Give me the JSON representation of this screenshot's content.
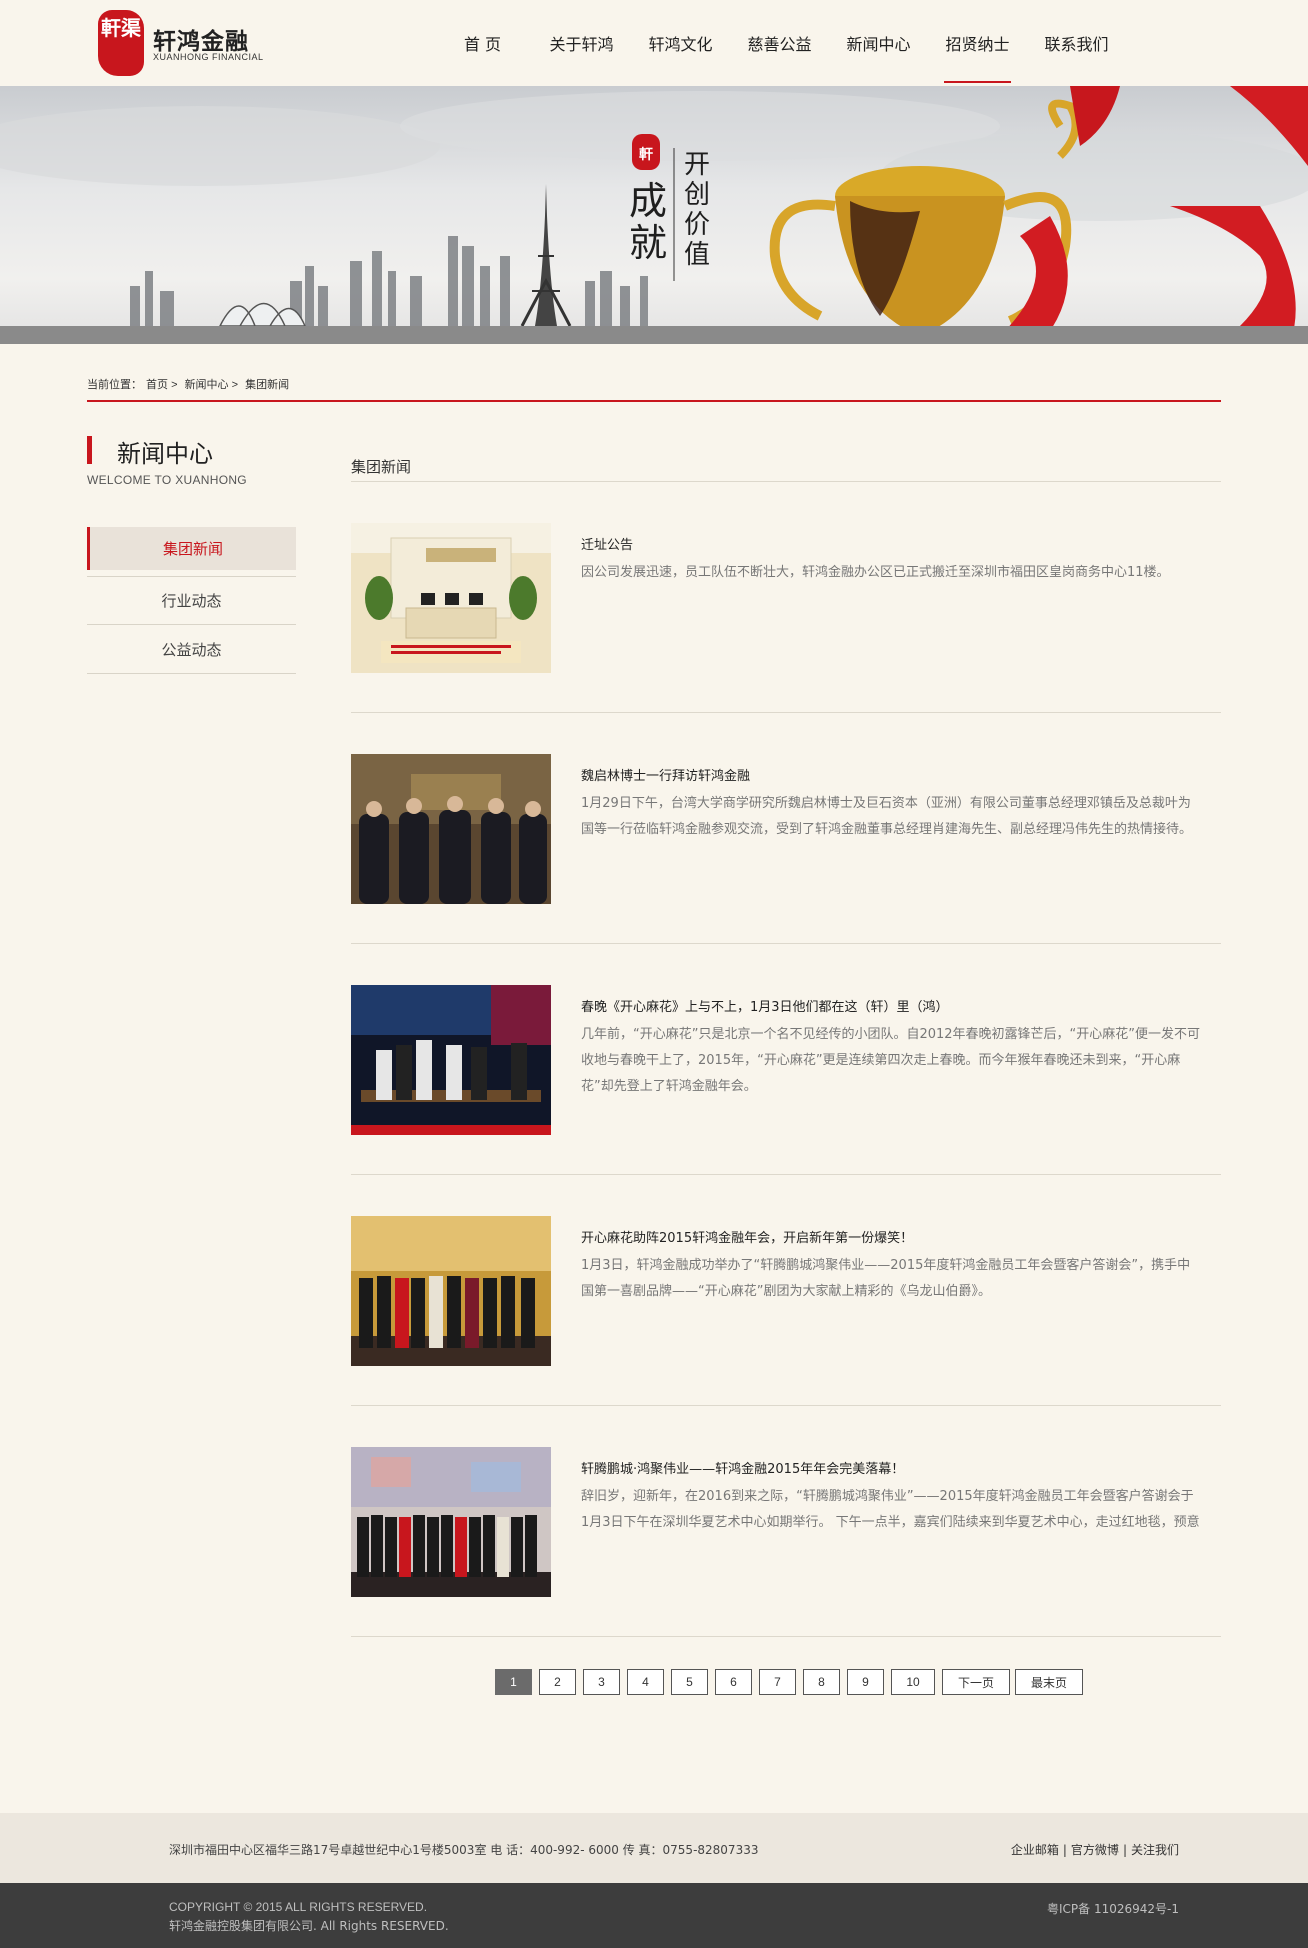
{
  "brand": {
    "seal_text": "軒渠",
    "name_cn": "轩鸿金融",
    "name_en": "XUANHONG FINANCIAL",
    "accent_color": "#c8161d"
  },
  "nav": {
    "items": [
      {
        "label": "首 页"
      },
      {
        "label": "关于轩鸿"
      },
      {
        "label": "轩鸿文化"
      },
      {
        "label": "慈善公益"
      },
      {
        "label": "新闻中心"
      },
      {
        "label": "招贤纳士"
      },
      {
        "label": "联系我们"
      }
    ],
    "active": "招贤纳士"
  },
  "banner": {
    "seal_text": "軒渠",
    "slogan_1": "成就",
    "slogan_2": "开创价值"
  },
  "breadcrumb": {
    "prefix": "当前位置：",
    "items": [
      "首页",
      "新闻中心",
      "集团新闻"
    ],
    "sep": ">"
  },
  "sidebar": {
    "title": "新闻中心",
    "subtitle": "WELCOME TO XUANHONG",
    "items": [
      {
        "label": "集团新闻"
      },
      {
        "label": "行业动态"
      },
      {
        "label": "公益动态"
      }
    ],
    "active": "集团新闻"
  },
  "content": {
    "title": "集团新闻",
    "news": [
      {
        "title": "迁址公告",
        "desc": "因公司发展迅速，员工队伍不断壮大，轩鸿金融办公区已正式搬迁至深圳市福田区皇岗商务中心11楼。",
        "thumb": "office-reception"
      },
      {
        "title": "魏启林博士一行拜访轩鸿金融",
        "desc": "1月29日下午，台湾大学商学研究所魏启林博士及巨石资本（亚洲）有限公司董事总经理邓镇岳及总裁叶为国等一行莅临轩鸿金融参观交流，受到了轩鸿金融董事总经理肖建海先生、副总经理冯伟先生的热情接待。",
        "thumb": "group-visit"
      },
      {
        "title": "春晚《开心麻花》上与不上，1月3日他们都在这（轩）里（鸿）",
        "desc": "几年前，“开心麻花”只是北京一个名不见经传的小团队。自2012年春晚初露锋芒后，“开心麻花”便一发不可收地与春晚干上了，2015年，“开心麻花”更是连续第四次走上春晚。而今年猴年春晚还未到来，“开心麻花”却先登上了轩鸿金融年会。",
        "thumb": "stage-show"
      },
      {
        "title": "开心麻花助阵2015轩鸿金融年会，开启新年第一份爆笑！",
        "desc": "1月3日，轩鸿金融成功举办了“轩腾鹏城鸿聚伟业——2015年度轩鸿金融员工年会暨客户答谢会”，携手中国第一喜剧品牌——“开心麻花”剧团为大家献上精彩的《乌龙山伯爵》。",
        "thumb": "annual-meeting"
      },
      {
        "title": "轩腾鹏城·鸿聚伟业——轩鸿金融2015年年会完美落幕！",
        "desc": "辞旧岁，迎新年，在2016到来之际，“轩腾鹏城鸿聚伟业”——2015年度轩鸿金融员工年会暨客户答谢会于1月3日下午在深圳华夏艺术中心如期举行。 下午一点半，嘉宾们陆续来到华夏艺术中心，走过红地毯，预意",
        "thumb": "group-photo"
      }
    ]
  },
  "pager": {
    "pages": [
      "1",
      "2",
      "3",
      "4",
      "5",
      "6",
      "7",
      "8",
      "9",
      "10"
    ],
    "current": "1",
    "next": "下一页",
    "last": "最末页"
  },
  "footer": {
    "address": "深圳市福田中心区福华三路17号卓越世纪中心1号楼5003室 电 话：400-992- 6000 传 真：0755-82807333",
    "links": [
      "企业邮箱",
      "官方微博",
      "关注我们"
    ],
    "copyright_en": "COPYRIGHT © 2015 ALL RIGHTS RESERVED.",
    "copyright_cn": "轩鸿金融控股集团有限公司. All Rights RESERVED.",
    "icp": "粤ICP备 11026942号-1"
  }
}
